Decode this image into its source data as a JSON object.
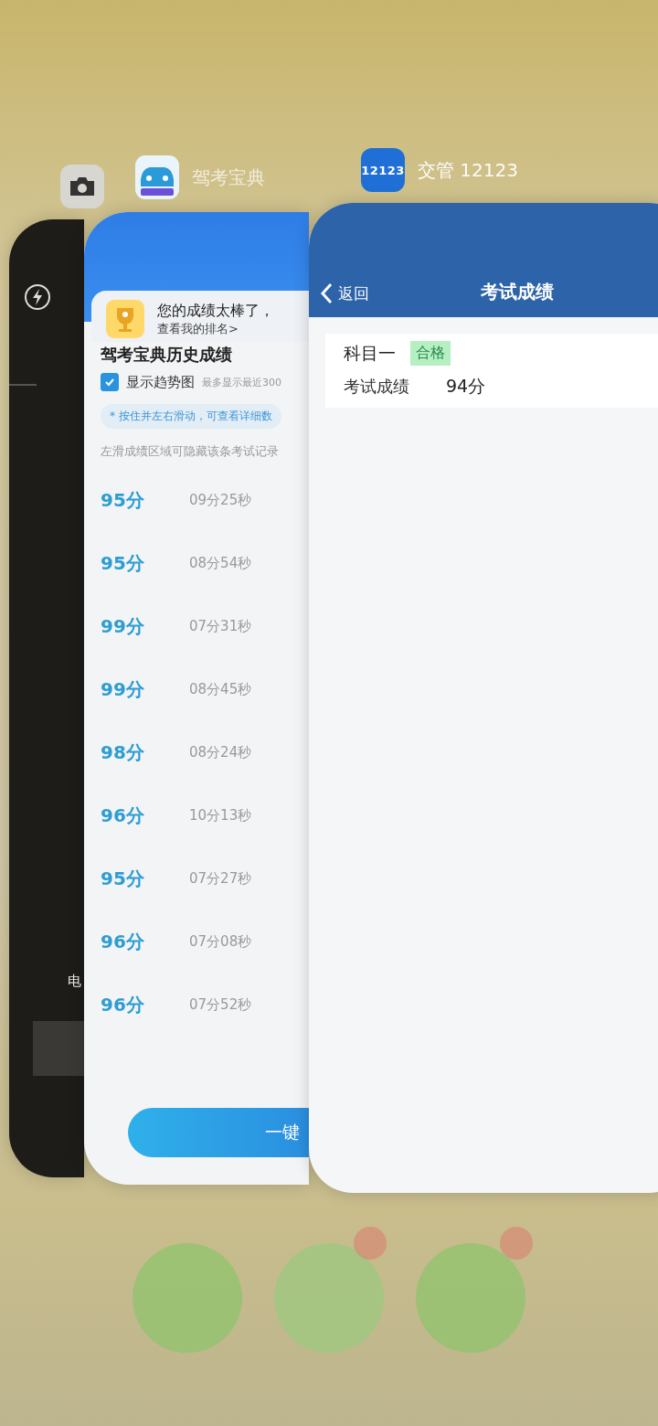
{
  "switcher": {
    "cards": [
      {
        "kind": "camera",
        "mode_label": "电"
      },
      {
        "kind": "jiakao",
        "app_name": "驾考宝典",
        "banner": {
          "title": "您的成绩太棒了，",
          "link": "查看我的排名>"
        },
        "heading": "驾考宝典历史成绩",
        "trend": {
          "label": "显示趋势图",
          "checked": true,
          "note": "最多显示最近300"
        },
        "hint": "* 按住并左右滑动，可查看详细数",
        "note": "左滑成绩区域可隐藏该条考试记录",
        "records": [
          {
            "score": "95分",
            "duration": "09分25秒"
          },
          {
            "score": "95分",
            "duration": "08分54秒"
          },
          {
            "score": "99分",
            "duration": "07分31秒"
          },
          {
            "score": "99分",
            "duration": "08分45秒"
          },
          {
            "score": "98分",
            "duration": "08分24秒"
          },
          {
            "score": "96分",
            "duration": "10分13秒"
          },
          {
            "score": "95分",
            "duration": "07分27秒"
          },
          {
            "score": "96分",
            "duration": "07分08秒"
          },
          {
            "score": "96分",
            "duration": "07分52秒"
          }
        ],
        "button": "一键"
      },
      {
        "kind": "traffic",
        "app_name": "交管 12123",
        "icon_text": "12123",
        "nav": {
          "back": "返回",
          "title": "考试成绩"
        },
        "result": {
          "subject": "科目一",
          "status": "合格",
          "passed": true,
          "score_label": "考试成绩",
          "score": "94分"
        }
      }
    ]
  }
}
